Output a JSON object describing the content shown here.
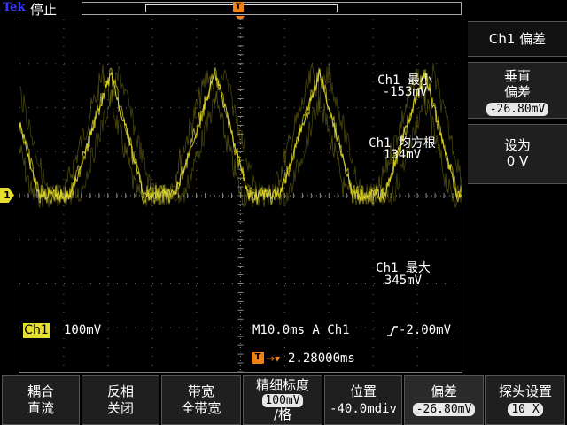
{
  "header": {
    "brand": "Tek",
    "run_state": "停止",
    "trigger_icon": "T"
  },
  "display": {
    "channel_marker": "1",
    "channel_marker_color": "#e6de2c",
    "trace_color": "#e6de2c",
    "trigger_color": "#f08018",
    "trigger_marker": "T",
    "measurements": [
      {
        "label": "Ch1 最小",
        "value": "-153mV"
      },
      {
        "label": "Ch1 均方根",
        "value": "134mV"
      },
      {
        "label": "Ch1 最大",
        "value": "345mV"
      }
    ],
    "channel_tag": "Ch1",
    "channel_scale": "100mV",
    "timebase": "M10.0ms A  Ch1",
    "trigger_edge_icon": "rising-edge-icon",
    "trigger_level": "-2.00mV",
    "trigger_delay": "2.28000ms"
  },
  "side_menu": {
    "title": "Ch1 偏差",
    "offset_label_1": "垂直",
    "offset_label_2": "偏差",
    "offset_value": "-26.80mV",
    "setto_label": "设为",
    "setto_value": "0 V"
  },
  "bottom_menu": [
    {
      "line1": "耦合",
      "line2": "直流"
    },
    {
      "line1": "反相",
      "line2": "关闭"
    },
    {
      "line1": "带宽",
      "line2": "全带宽"
    },
    {
      "line1": "精细标度",
      "line2": "100mV",
      "line3": "/格"
    },
    {
      "line1": "位置",
      "line2": "-40.0mdiv"
    },
    {
      "line1": "偏差",
      "line2": "-26.80mV"
    },
    {
      "line1": "探头设置",
      "line2": "10 X"
    }
  ]
}
